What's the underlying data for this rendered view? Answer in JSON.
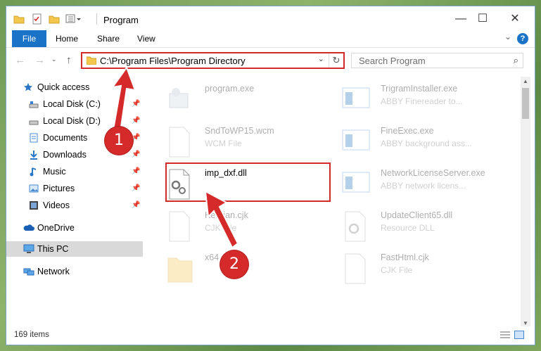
{
  "window": {
    "title": "Program",
    "controls": {
      "minimize": "—",
      "maximize": "☐",
      "close": "✕"
    }
  },
  "ribbon": {
    "tabs": [
      "File",
      "Home",
      "Share",
      "View"
    ],
    "expand": "⌄",
    "help": "?"
  },
  "address": {
    "path": "C:\\Program Files\\Program Directory",
    "chevron": "⌄",
    "refresh": "↻"
  },
  "search": {
    "placeholder": "Search Program"
  },
  "nav": {
    "items": [
      {
        "label": "Quick access",
        "icon": "star-icon"
      },
      {
        "label": "Local Disk (C:)",
        "icon": "drive-icon",
        "pinned": true
      },
      {
        "label": "Local Disk (D:)",
        "icon": "drive-icon",
        "pinned": true
      },
      {
        "label": "Documents",
        "icon": "documents-icon",
        "pinned": true
      },
      {
        "label": "Downloads",
        "icon": "download-icon",
        "pinned": true
      },
      {
        "label": "Music",
        "icon": "music-icon",
        "pinned": true
      },
      {
        "label": "Pictures",
        "icon": "pictures-icon",
        "pinned": true
      },
      {
        "label": "Videos",
        "icon": "videos-icon",
        "pinned": true
      },
      {
        "label": "OneDrive",
        "icon": "cloud-icon"
      },
      {
        "label": "This PC",
        "icon": "computer-icon",
        "selected": true
      },
      {
        "label": "Network",
        "icon": "network-icon"
      }
    ]
  },
  "files": [
    {
      "name": "program.exe",
      "desc": "",
      "faded": true
    },
    {
      "name": "TrigramInstaller.exe",
      "desc": "ABBY Finereader to...",
      "faded": true
    },
    {
      "name": "SndToWP15.wcm",
      "desc": "WCM File",
      "faded": true
    },
    {
      "name": "FineExec.exe",
      "desc": "ABBY background ass...",
      "faded": true
    },
    {
      "name": "imp_dxf.dll",
      "desc": "",
      "faded": false
    },
    {
      "name": "NetworkLicenseServer.exe",
      "desc": "ABBY network licens...",
      "faded": true
    },
    {
      "name": "Kernian.cjk",
      "desc": "CJK File",
      "faded": true
    },
    {
      "name": "UpdateClient65.dll",
      "desc": "Resource DLL",
      "faded": true
    },
    {
      "name": "x64",
      "desc": "",
      "faded": true
    },
    {
      "name": "FastHtml.cjk",
      "desc": "CJK File",
      "faded": true
    }
  ],
  "status": {
    "item_count": "169 items"
  },
  "annotations": {
    "step1": "1",
    "step2": "2"
  },
  "colors": {
    "accent": "#1a73c6",
    "annotation": "#d42a2a",
    "selection": "#d9d9d9"
  }
}
